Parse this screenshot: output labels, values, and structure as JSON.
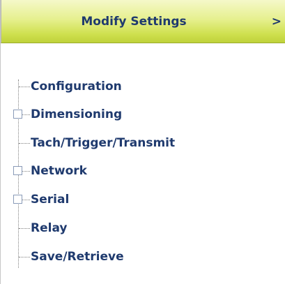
{
  "header": {
    "title": "Modify Settings",
    "arrow": ">"
  },
  "tree": {
    "items": [
      {
        "label": "Configuration",
        "expandable": false
      },
      {
        "label": "Dimensioning",
        "expandable": true
      },
      {
        "label": "Tach/Trigger/Transmit",
        "expandable": false
      },
      {
        "label": "Network",
        "expandable": true
      },
      {
        "label": "Serial",
        "expandable": true
      },
      {
        "label": "Relay",
        "expandable": false
      },
      {
        "label": "Save/Retrieve",
        "expandable": false
      }
    ]
  },
  "colors": {
    "header_gradient_top": "#f5f8c9",
    "header_gradient_bottom": "#bfd23a",
    "text": "#1f3a6e"
  }
}
